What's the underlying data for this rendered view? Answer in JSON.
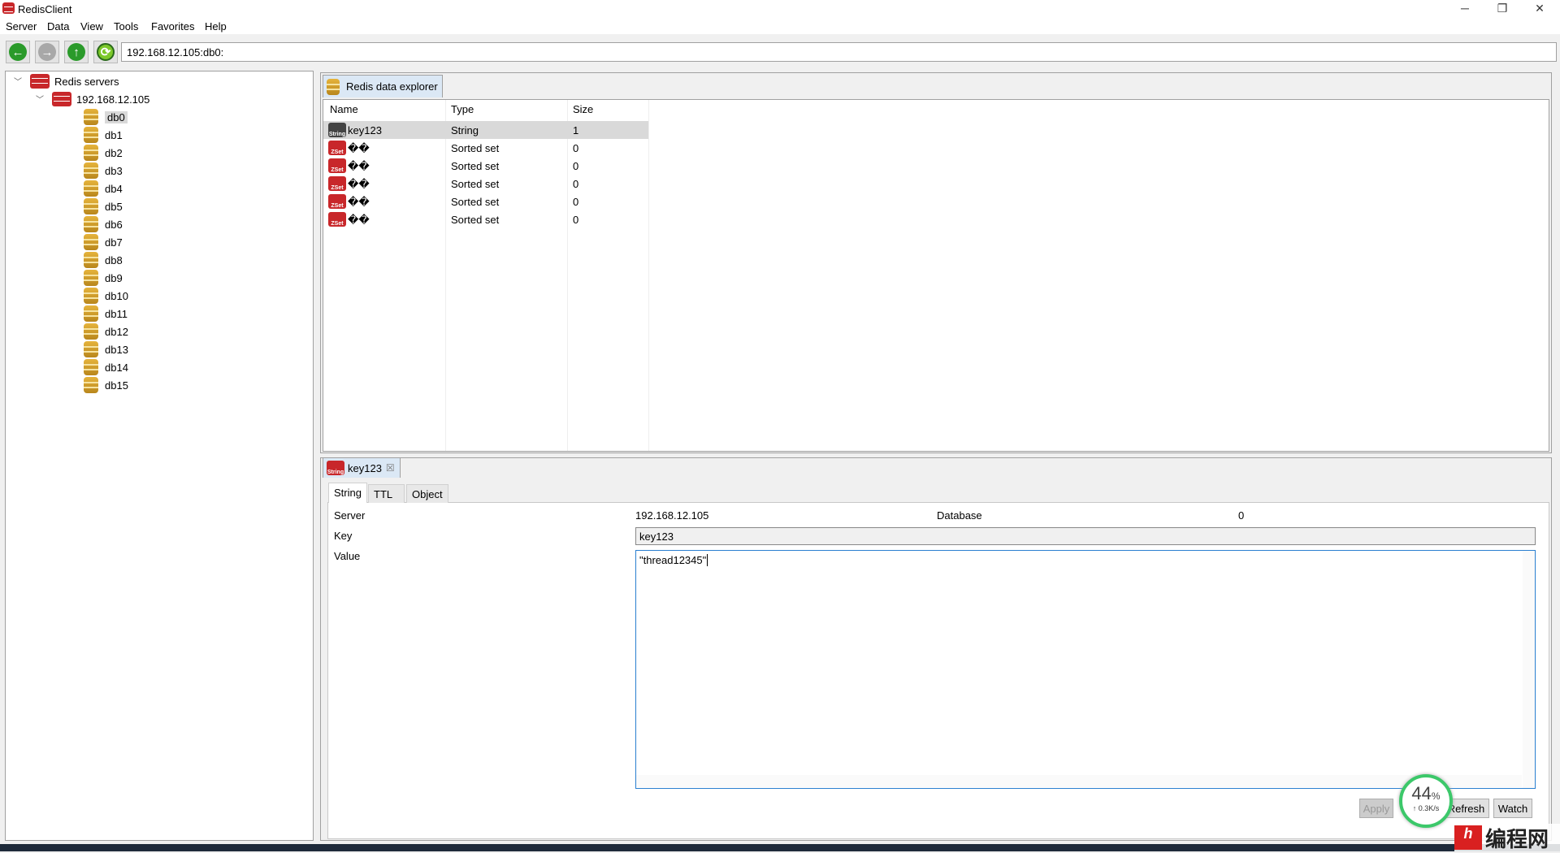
{
  "app": {
    "title": "RedisClient"
  },
  "window_controls": {
    "minimize": "─",
    "maximize": "❐",
    "close": "✕"
  },
  "menu": [
    "Server",
    "Data",
    "View",
    "Tools",
    "Favorites",
    "Help"
  ],
  "toolbar": {
    "address": "192.168.12.105:db0:",
    "back": "←",
    "forward": "→",
    "up": "↑",
    "refresh": "⟳"
  },
  "tree": {
    "root": "Redis servers",
    "server": "192.168.12.105",
    "dbs": [
      "db0",
      "db1",
      "db2",
      "db3",
      "db4",
      "db5",
      "db6",
      "db7",
      "db8",
      "db9",
      "db10",
      "db11",
      "db12",
      "db13",
      "db14",
      "db15"
    ],
    "selected": "db0"
  },
  "explorer": {
    "tab": "Redis data explorer",
    "columns": [
      "Name",
      "Type",
      "Size"
    ],
    "rows": [
      {
        "icon": "String",
        "name": "key123",
        "type": "String",
        "size": "1"
      },
      {
        "icon": "ZSet",
        "name": "��",
        "type": "Sorted set",
        "size": "0"
      },
      {
        "icon": "ZSet",
        "name": "��",
        "type": "Sorted set",
        "size": "0"
      },
      {
        "icon": "ZSet",
        "name": "��",
        "type": "Sorted set",
        "size": "0"
      },
      {
        "icon": "ZSet",
        "name": "��",
        "type": "Sorted set",
        "size": "0"
      },
      {
        "icon": "ZSet",
        "name": "��",
        "type": "Sorted set",
        "size": "0"
      }
    ]
  },
  "detail": {
    "tab": "key123",
    "tab_icon": "String",
    "close": "☒",
    "subtabs": [
      "String",
      "TTL",
      "Object"
    ],
    "server_label": "Server",
    "server": "192.168.12.105",
    "database_label": "Database",
    "database": "0",
    "key_label": "Key",
    "key": "key123",
    "value_label": "Value",
    "value": "\"thread12345\"",
    "buttons": {
      "apply": "Apply",
      "refresh": "Refresh",
      "watch": "Watch"
    }
  },
  "overlay": {
    "percent": "44",
    "unit": "%",
    "speed": "↑ 0.3K/s",
    "progress": 0.44
  },
  "watermark": {
    "text": "编程网"
  },
  "colors": {
    "accent": "#2a7fd0",
    "redis_red": "#c8272a",
    "gauge_green": "#3cc86a"
  }
}
